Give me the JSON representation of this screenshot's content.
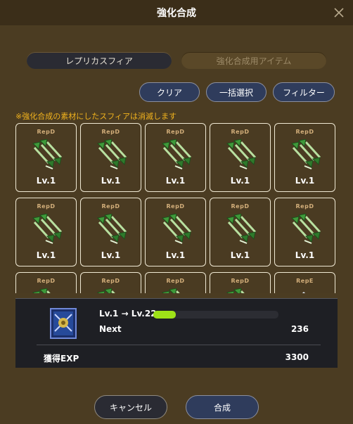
{
  "header": {
    "title": "強化合成",
    "close_icon": "close-icon"
  },
  "tabs": [
    {
      "label": "レプリカスフィア",
      "active": true
    },
    {
      "label": "強化合成用アイテム",
      "active": false
    }
  ],
  "actions": {
    "clear": "クリア",
    "select_all": "一括選択",
    "filter": "フィルター"
  },
  "notice": "※強化合成の素材にしたスフィアは消滅します",
  "cards": [
    {
      "tag": "RepD",
      "level": "Lv.1",
      "icon": "green-axe-icon"
    },
    {
      "tag": "RepD",
      "level": "Lv.1",
      "icon": "green-axe-icon"
    },
    {
      "tag": "RepD",
      "level": "Lv.1",
      "icon": "green-axe-icon"
    },
    {
      "tag": "RepD",
      "level": "Lv.1",
      "icon": "green-axe-icon"
    },
    {
      "tag": "RepD",
      "level": "Lv.1",
      "icon": "green-axe-icon"
    },
    {
      "tag": "RepD",
      "level": "Lv.1",
      "icon": "green-axe-icon"
    },
    {
      "tag": "RepD",
      "level": "Lv.1",
      "icon": "green-axe-icon"
    },
    {
      "tag": "RepD",
      "level": "Lv.1",
      "icon": "green-axe-icon"
    },
    {
      "tag": "RepD",
      "level": "Lv.1",
      "icon": "green-axe-icon"
    },
    {
      "tag": "RepD",
      "level": "Lv.1",
      "icon": "green-axe-icon"
    },
    {
      "tag": "RepD",
      "level": "",
      "icon": "green-axe-icon"
    },
    {
      "tag": "RepD",
      "level": "",
      "icon": "green-axe-icon"
    },
    {
      "tag": "RepD",
      "level": "",
      "icon": "green-axe-icon"
    },
    {
      "tag": "RepD",
      "level": "",
      "icon": "green-axe-icon"
    },
    {
      "tag": "RepE",
      "level": "",
      "icon": "sword-icon"
    }
  ],
  "info": {
    "thumbnail_icon": "banner-sphere-icon",
    "level_change": "Lv.1 → Lv.22",
    "exp_progress": 0.18,
    "next_label": "Next",
    "next_value": "236",
    "exp_label": "獲得EXP",
    "exp_value": "3300"
  },
  "footer": {
    "cancel": "キャンセル",
    "confirm": "合成"
  },
  "colors": {
    "accent_green": "#9ee218",
    "notice": "#f2b31d",
    "button_blue": "#2f3c5c"
  }
}
